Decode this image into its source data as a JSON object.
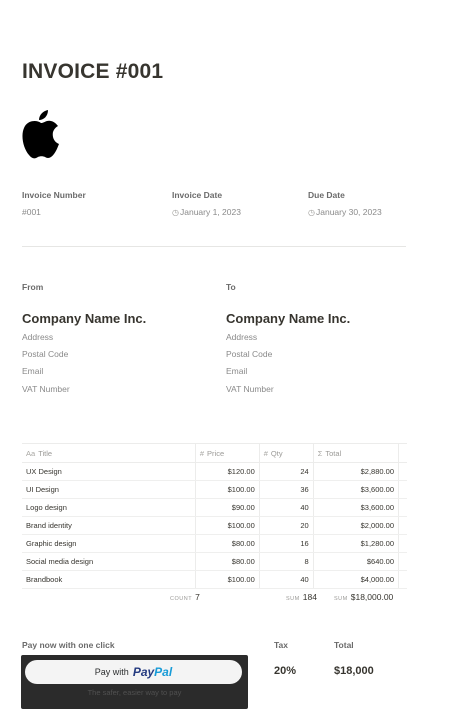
{
  "invoice": {
    "title": "INVOICE #001"
  },
  "meta": {
    "number_label": "Invoice Number",
    "number_value": "#001",
    "date_label": "Invoice Date",
    "date_value": "January 1, 2023",
    "due_label": "Due Date",
    "due_value": "January 30, 2023"
  },
  "from": {
    "label": "From",
    "company": "Company Name Inc.",
    "address": "Address",
    "postal": "Postal Code",
    "email": "Email",
    "vat": "VAT Number"
  },
  "to": {
    "label": "To",
    "company": "Company Name Inc.",
    "address": "Address",
    "postal": "Postal Code",
    "email": "Email",
    "vat": "VAT Number"
  },
  "table": {
    "headers": [
      "Title",
      "Price",
      "Qty",
      "Total"
    ],
    "header_icons": [
      "Aa",
      "#",
      "#",
      "Σ"
    ],
    "rows": [
      {
        "title": "UX Design",
        "price": "$120.00",
        "qty": "24",
        "total": "$2,880.00"
      },
      {
        "title": "UI Design",
        "price": "$100.00",
        "qty": "36",
        "total": "$3,600.00"
      },
      {
        "title": "Logo design",
        "price": "$90.00",
        "qty": "40",
        "total": "$3,600.00"
      },
      {
        "title": "Brand identity",
        "price": "$100.00",
        "qty": "20",
        "total": "$2,000.00"
      },
      {
        "title": "Graphic design",
        "price": "$80.00",
        "qty": "16",
        "total": "$1,280.00"
      },
      {
        "title": "Social media design",
        "price": "$80.00",
        "qty": "8",
        "total": "$640.00"
      },
      {
        "title": "Brandbook",
        "price": "$100.00",
        "qty": "40",
        "total": "$4,000.00"
      }
    ],
    "count_label": "COUNT",
    "count_value": "7",
    "qty_sum_label": "SUM",
    "qty_sum_value": "184",
    "total_sum_label": "SUM",
    "total_sum_value": "$18,000.00"
  },
  "payment": {
    "label": "Pay now with one click",
    "button_prefix": "Pay with",
    "paypal_a": "Pay",
    "paypal_b": "Pal",
    "tagline": "The safer, easier way to pay"
  },
  "summary": {
    "tax_label": "Tax",
    "tax_value": "20%",
    "total_label": "Total",
    "total_value": "$18,000"
  },
  "colors": {
    "text": "#37352f",
    "muted": "#8a8a8a",
    "paypal_dark": "#253b80",
    "paypal_light": "#179bd7",
    "pay_box": "#2b2b2b"
  },
  "icons": {
    "logo": "apple-logo-icon",
    "calendar": "calendar-icon"
  }
}
